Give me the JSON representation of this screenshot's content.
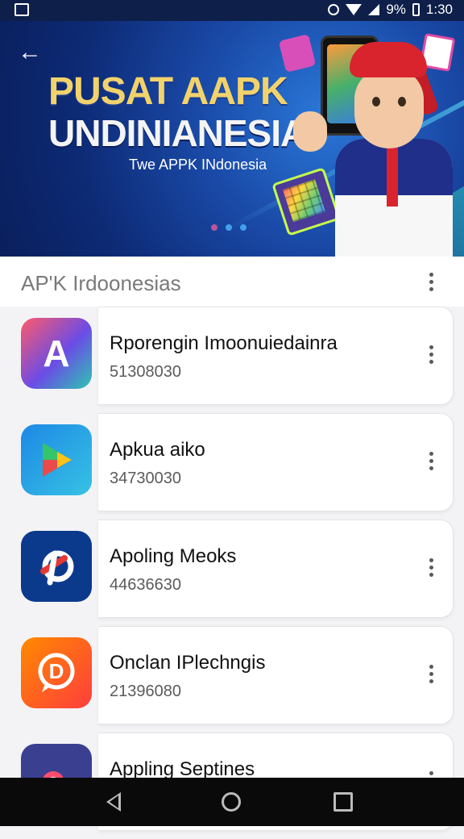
{
  "status_bar": {
    "battery": "9%",
    "time": "1:30"
  },
  "hero": {
    "title_line1": "PUSAT AAPK",
    "title_line2": "UNDINIANESIA",
    "subtitle": "Twe APPK INdonesia"
  },
  "section": {
    "title": "AP'K Irdoonesias"
  },
  "apps": [
    {
      "name": "Rporengin Imoonuiedainra",
      "number": "51308030",
      "icon": "a-logo-icon",
      "icon_text": "A",
      "colors": [
        "#ff5a6a",
        "#6b4ce6",
        "#2cc7b0"
      ]
    },
    {
      "name": "Apkua aiko",
      "number": "34730030",
      "icon": "play-store-icon",
      "icon_text": "",
      "colors": [
        "#1e88e5",
        "#36c2e4"
      ]
    },
    {
      "name": "Apoling Meoks",
      "number": "44636630",
      "icon": "stylized-p-logo-icon",
      "icon_text": "ᴾ",
      "colors": [
        "#0b3a8c",
        "#1a4fb0"
      ]
    },
    {
      "name": "Onclan IPlechngis",
      "number": "21396080",
      "icon": "speech-d-logo-icon",
      "icon_text": "D",
      "colors": [
        "#ff6a00",
        "#ff3d3d"
      ]
    },
    {
      "name": "Appling Septines",
      "number": "",
      "icon": "colorful-ring-icon",
      "icon_text": "",
      "colors": [
        "#3a3f8f",
        "#ff4d6d",
        "#ffc21a"
      ]
    }
  ]
}
